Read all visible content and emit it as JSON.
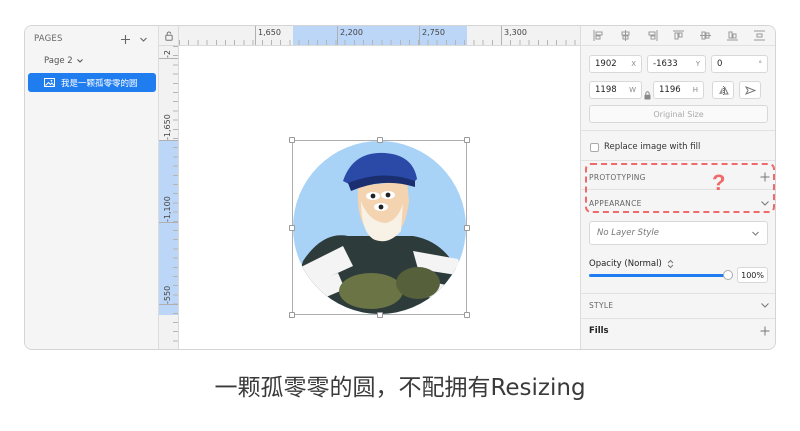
{
  "pages_panel": {
    "title": "PAGES",
    "current_page": "Page 2",
    "layers": [
      {
        "label": "我是一颗孤零零的圆",
        "icon": "image-icon"
      }
    ]
  },
  "rulers": {
    "top_labels": [
      "1,650",
      "2,200",
      "2,750",
      "3,300"
    ],
    "left_labels": [
      "-2",
      "-1,650",
      "-1,100",
      "-550"
    ]
  },
  "inspector": {
    "position": {
      "x": "1902",
      "x_suffix": "X",
      "y": "-1633",
      "y_suffix": "Y",
      "rotation": "0",
      "rotation_suffix": "°"
    },
    "size": {
      "w": "1198",
      "w_suffix": "W",
      "h": "1196",
      "h_suffix": "H"
    },
    "original_size_label": "Original Size",
    "replace_fill_label": "Replace image with fill",
    "prototyping_label": "PROTOTYPING",
    "appearance_label": "APPEARANCE",
    "layer_style_placeholder": "No Layer Style",
    "opacity_label": "Opacity (Normal)",
    "opacity_value": "100%",
    "opacity_fraction": 1.0,
    "style_label": "STYLE",
    "fills_label": "Fills",
    "annotation_mark": "?"
  },
  "colors": {
    "accent": "#1f7df0",
    "annotation": "#ef6a6a"
  },
  "caption": "一颗孤零零的圆，不配拥有Resizing"
}
